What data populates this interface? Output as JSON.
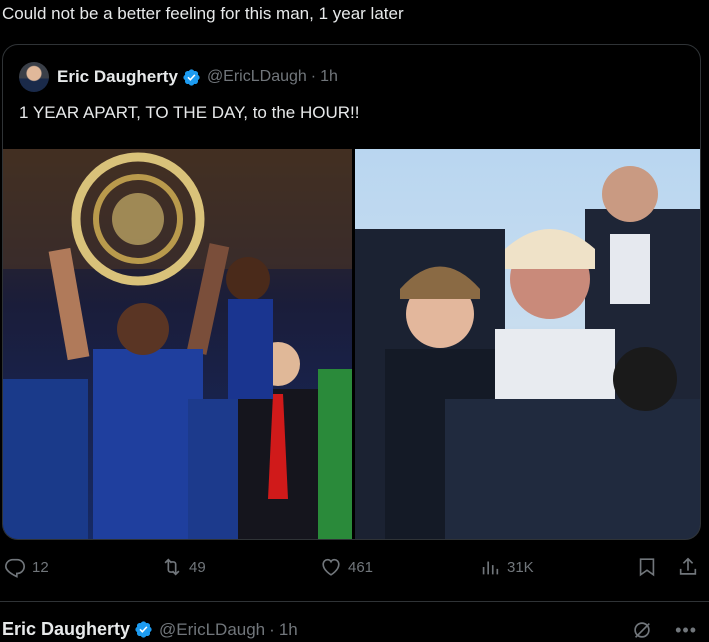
{
  "tweet": {
    "text": "Could not be a better feeling for this man, 1 year later"
  },
  "quote": {
    "author_name": "Eric Daugherty",
    "handle": "@EricLDaugh",
    "separator": "·",
    "time": "1h",
    "text": "1 YEAR APART, TO THE DAY, to the HOUR!!"
  },
  "actions": {
    "replies": "12",
    "reposts": "49",
    "likes": "461",
    "views": "31K"
  },
  "next_reply": {
    "author_name": "Eric Daugherty",
    "handle": "@EricLDaugh",
    "separator": "·",
    "time": "1h"
  },
  "icons": [
    "verified-icon",
    "reply-icon",
    "repost-icon",
    "like-icon",
    "views-icon",
    "bookmark-icon",
    "share-icon",
    "grok-icon",
    "more-icon"
  ],
  "colors": {
    "background": "#000000",
    "text": "#e7e9ea",
    "muted": "#71767b",
    "border": "#2f3336",
    "verified": "#1d9bf0"
  }
}
